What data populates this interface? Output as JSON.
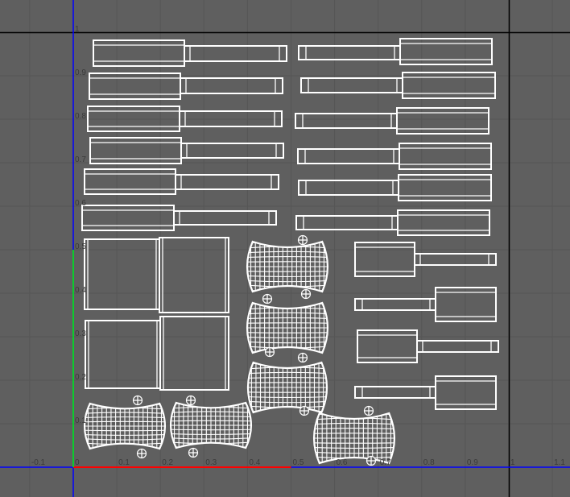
{
  "view": {
    "name": "UV Editor viewport",
    "background": "#5f5f5f",
    "grid_color": "#565656",
    "island_color": "#ffffff"
  },
  "axes": {
    "x_ticks": [
      "-0.1",
      "0",
      "0.1",
      "0.2",
      "0.3",
      "0.4",
      "0.5",
      "0.6",
      "0.7",
      "0.8",
      "0.9",
      "1",
      "1.1"
    ],
    "x_values": [
      -0.1,
      0,
      0.1,
      0.2,
      0.3,
      0.4,
      0.5,
      0.6,
      0.7,
      0.8,
      0.9,
      1,
      1.1
    ],
    "y_ticks": [
      "1",
      "0.9",
      "0.8",
      "0.7",
      "0.6",
      "0.5",
      "0.4",
      "0.3",
      "0.2",
      "0.1"
    ],
    "y_values": [
      1,
      0.9,
      0.8,
      0.7,
      0.6,
      0.5,
      0.4,
      0.3,
      0.2,
      0.1
    ],
    "u_axis_color": "#ff0000",
    "v_axis_color": "#00ff00",
    "axis_line_color": "#0000ff"
  }
}
